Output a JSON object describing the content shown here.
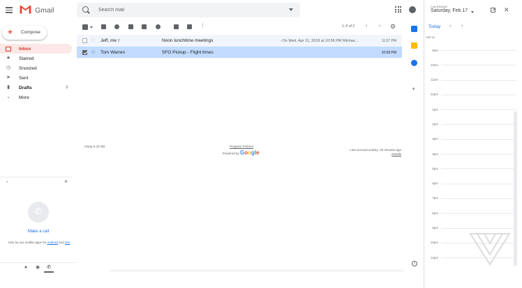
{
  "app": {
    "name": "Gmail"
  },
  "search": {
    "placeholder": "Search mail"
  },
  "compose": {
    "label": "Compose"
  },
  "sidebar": {
    "items": [
      {
        "label": "Inbox",
        "icon": "inbox-icon",
        "active": true,
        "count": ""
      },
      {
        "label": "Starred",
        "icon": "star-icon",
        "active": false,
        "count": ""
      },
      {
        "label": "Snoozed",
        "icon": "clock-icon",
        "active": false,
        "count": ""
      },
      {
        "label": "Sent",
        "icon": "send-icon",
        "active": false,
        "count": ""
      },
      {
        "label": "Drafts",
        "icon": "draft-icon",
        "active": false,
        "count": "3"
      },
      {
        "label": "More",
        "icon": "chevron-down-icon",
        "active": false,
        "count": ""
      }
    ]
  },
  "hangouts": {
    "make_call": "Make a call",
    "also_prefix": "Also try our mobile apps for",
    "android": "Android",
    "and": "and",
    "ios": "iOS"
  },
  "toolbar": {
    "page_range": "1–2 of 2"
  },
  "emails": [
    {
      "sender": "Jeff, me",
      "count": "2",
      "subject": "Noon lunchtime meetings",
      "snippet": "- On Wed, Apr 11, 2018 at 10:56 PM Michae...",
      "time": "11:07 PM",
      "selected": false
    },
    {
      "sender": "Tom Warren",
      "count": "",
      "subject": "SFO Pickup",
      "snippet": "- Flight times",
      "time": "10:58 PM",
      "selected": true
    }
  ],
  "footer": {
    "usage": "Using 0.43 GB",
    "program_policies": "Program Policies",
    "powered_by": "Powered by",
    "google": [
      "G",
      "o",
      "o",
      "g",
      "l",
      "e"
    ],
    "last_activity": "Last account activity: 20 minutes ago",
    "details": "Details"
  },
  "calendar": {
    "kicker": "CALENDAR",
    "date": "Saturday, Feb 17",
    "today": "Today",
    "timezone": "GMT-04",
    "hours": [
      "9am",
      "10am",
      "11am",
      "12pm",
      "1pm",
      "2pm",
      "3pm",
      "4pm",
      "5pm",
      "6pm",
      "7pm",
      "8pm",
      "9pm",
      "10pm",
      "11pm"
    ]
  },
  "colors": {
    "gmail_red": "#d93025",
    "selected_row": "#c2dbff",
    "inbox_highlight": "#fce8e6",
    "link_blue": "#1a73e8"
  }
}
